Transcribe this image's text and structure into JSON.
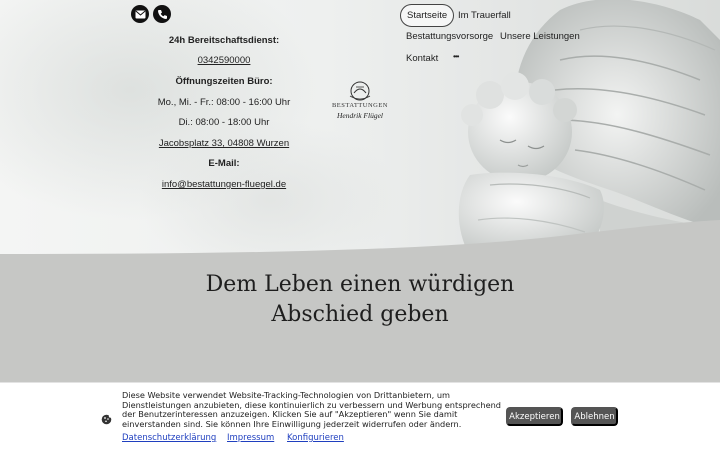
{
  "contact": {
    "icons": [
      "mail-icon",
      "phone-icon"
    ],
    "emergency_label": "24h Bereitschaftsdienst:",
    "phone": "0342590000",
    "hours_label": "Öffnungszeiten Büro:",
    "hours_1": "Mo., Mi. - Fr.: 08:00 - 16:00 Uhr",
    "hours_2": "Di.: 08:00 - 18:00 Uhr",
    "address": "Jacobsplatz 33, 04808 Wurzen",
    "email_label": "E-Mail:",
    "email": "info@bestattungen-fluegel.de"
  },
  "logo": {
    "line1": "BESTATTUNGEN",
    "line2": "Hendrik Flügel"
  },
  "nav": {
    "items": [
      "Startseite",
      "Im Trauerfall",
      "Bestattungsvorsorge",
      "Unsere Leistungen",
      "Kontakt"
    ],
    "more": "•••",
    "active": "Startseite"
  },
  "hero": {
    "headline_line1": "Dem Leben einen würdigen",
    "headline_line2": "Abschied geben"
  },
  "cookie": {
    "text": "Diese Website verwendet Website-Tracking-Technologien von Drittanbietern, um Dienstleistungen anzubieten, diese kontinuierlich zu verbessern und Werbung entsprechend der Benutzerinteressen anzuzeigen. Klicken Sie auf \"Akzeptieren\" wenn Sie damit einverstanden sind. Sie können Ihre Einwilligung jederzeit widerrufen oder ändern.",
    "links": [
      "Datenschutzerklärung",
      "Impressum",
      "Konfigurieren"
    ],
    "accept": "Akzeptieren",
    "decline": "Ablehnen"
  },
  "colors": {
    "band": "#c6c7c5",
    "button": "#555555",
    "link": "#1f3fbf"
  }
}
